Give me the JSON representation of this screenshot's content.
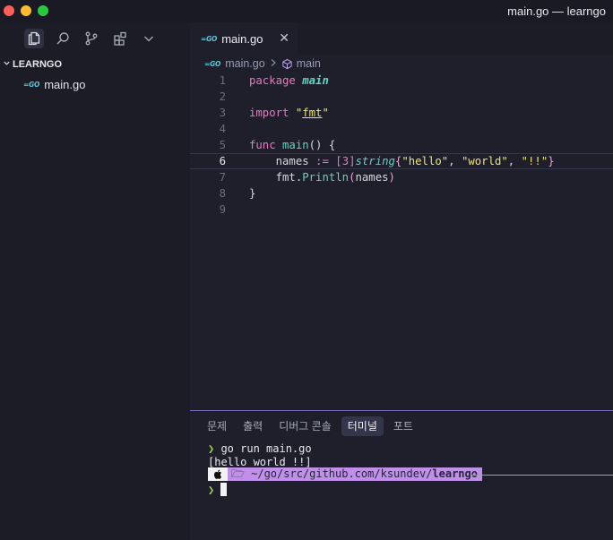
{
  "window": {
    "title": "main.go — learngo"
  },
  "activity_bar": {
    "icons": [
      "explorer-icon",
      "search-icon",
      "source-control-icon",
      "extensions-icon",
      "chevron-down-icon"
    ]
  },
  "sidebar": {
    "section_title": "LEARNGO",
    "files": [
      {
        "badge": "=GO",
        "name": "main.go"
      }
    ]
  },
  "editor": {
    "tab": {
      "badge": "=GO",
      "label": "main.go",
      "close": "✕"
    },
    "breadcrumb": {
      "file_badge": "=GO",
      "file": "main.go",
      "symbol": "main"
    },
    "current_line": 6,
    "line_numbers": [
      "1",
      "2",
      "3",
      "4",
      "5",
      "6",
      "7",
      "8",
      "9"
    ],
    "code": {
      "l1_kw": "package",
      "l1_name": "main",
      "l3_kw": "import",
      "l3_q1": "\"",
      "l3_pkg": "fmt",
      "l3_q2": "\"",
      "l5_kw": "func",
      "l5_name": "main",
      "l5_rest": "() {",
      "l6_indent": "    ",
      "l6_var": "names",
      "l6_op": " := ",
      "l6_br1": "[",
      "l6_num": "3",
      "l6_br2": "]",
      "l6_type": "string",
      "l6_cb1": "{",
      "l6_s1": "\"hello\"",
      "l6_c1": ", ",
      "l6_s2": "\"world\"",
      "l6_c2": ", ",
      "l6_s3": "\"!!\"",
      "l6_cb2": "}",
      "l7_indent": "    ",
      "l7_pkg": "fmt",
      "l7_dot": ".",
      "l7_fn": "Println",
      "l7_p1": "(",
      "l7_arg": "names",
      "l7_p2": ")",
      "l8": "}"
    }
  },
  "panel": {
    "tabs": [
      "문제",
      "출력",
      "디버그 콘솔",
      "터미널",
      "포트"
    ],
    "active_tab": "터미널",
    "terminal": {
      "prompt_symbol": "❯",
      "command": " go run main.go",
      "output": "[hello world !!]",
      "apple": "",
      "folder_glyph": "🗁",
      "path_prefix": " ~/go/src/github.com/ksundev/",
      "path_dir": "learngo"
    }
  },
  "colors": {
    "accent": "#7e6fb8",
    "keyword": "#e47bbf",
    "function": "#5fd4c4",
    "string": "#f0e36a",
    "prompt": "#98d35a",
    "path_bg": "#c090e8"
  }
}
